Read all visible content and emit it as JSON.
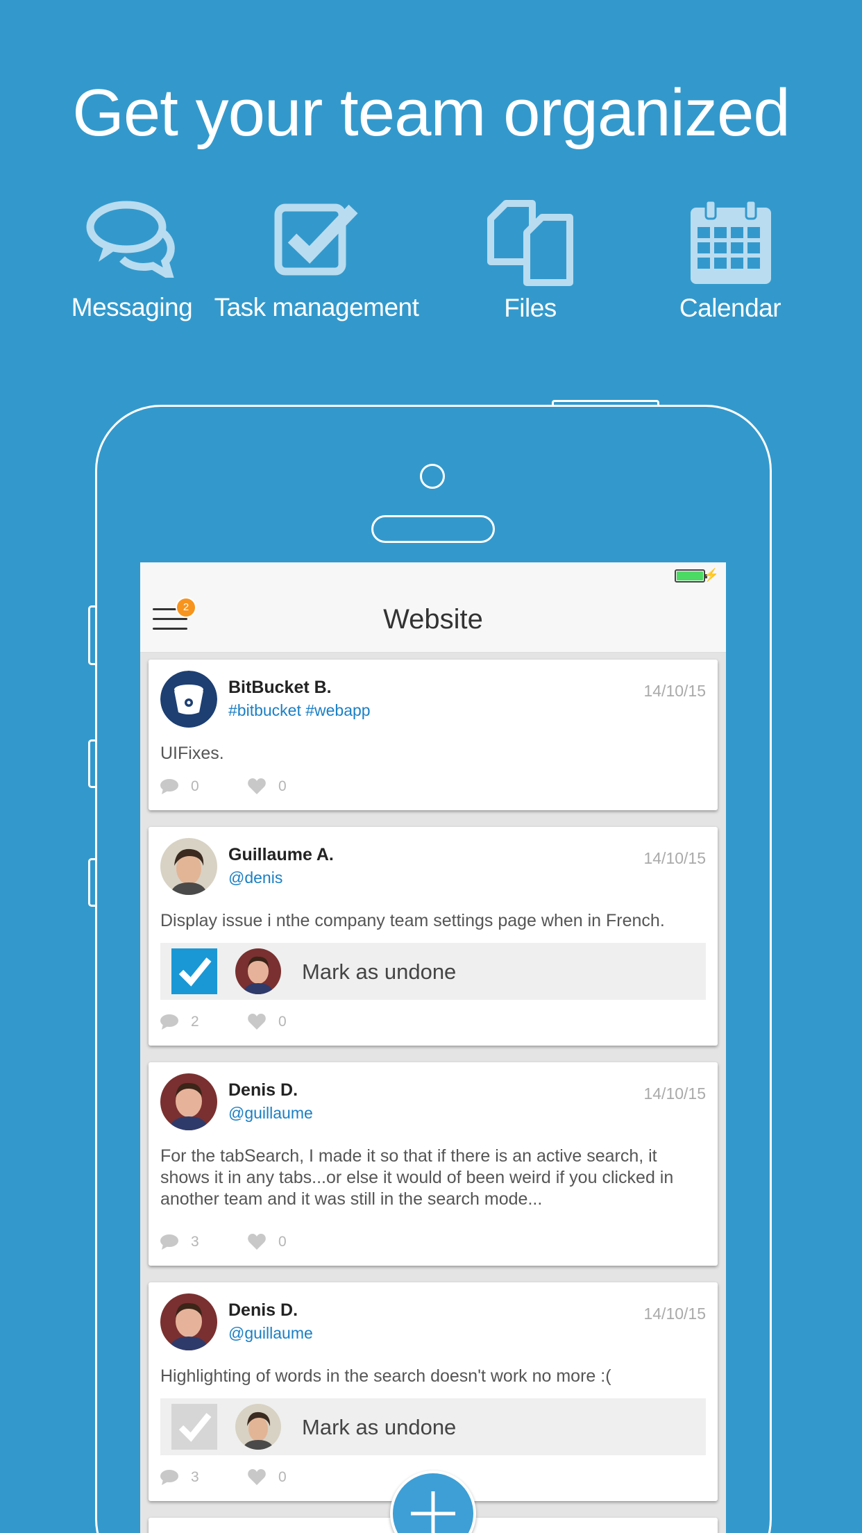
{
  "headline": "Get your team organized",
  "features": [
    {
      "label": "Messaging",
      "icon": "speech-bubbles-icon"
    },
    {
      "label": "Task management",
      "icon": "checkbox-icon"
    },
    {
      "label": "Files",
      "icon": "files-icon"
    },
    {
      "label": "Calendar",
      "icon": "calendar-icon"
    }
  ],
  "app": {
    "title": "Website",
    "menu_badge": "2",
    "posts": [
      {
        "author": "BitBucket B.",
        "handle": "#bitbucket #webapp",
        "date": "14/10/15",
        "body": "UIFixes.",
        "comments": "0",
        "likes": "0"
      },
      {
        "author": "Guillaume A.",
        "handle": "@denis",
        "date": "14/10/15",
        "body": "Display issue i nthe company team settings page when in French.",
        "task_label": "Mark as undone",
        "comments": "2",
        "likes": "0"
      },
      {
        "author": "Denis D.",
        "handle": "@guillaume",
        "date": "14/10/15",
        "body": "For the tabSearch, I made it so that if there is an active search, it shows it in any tabs...or else it would of been weird if you clicked in another team and it was still in the search mode...",
        "comments": "3",
        "likes": "0"
      },
      {
        "author": "Denis D.",
        "handle": "@guillaume",
        "date": "14/10/15",
        "body": "Highlighting of words in the search doesn't work no more :(",
        "task_label": "Mark as undone",
        "comments": "3",
        "likes": "0"
      }
    ]
  },
  "colors": {
    "background": "#3399cc",
    "link": "#1a7fc4",
    "badge": "#f7941d",
    "check_active": "#1a98d5",
    "check_inactive": "#d6d6d6"
  }
}
